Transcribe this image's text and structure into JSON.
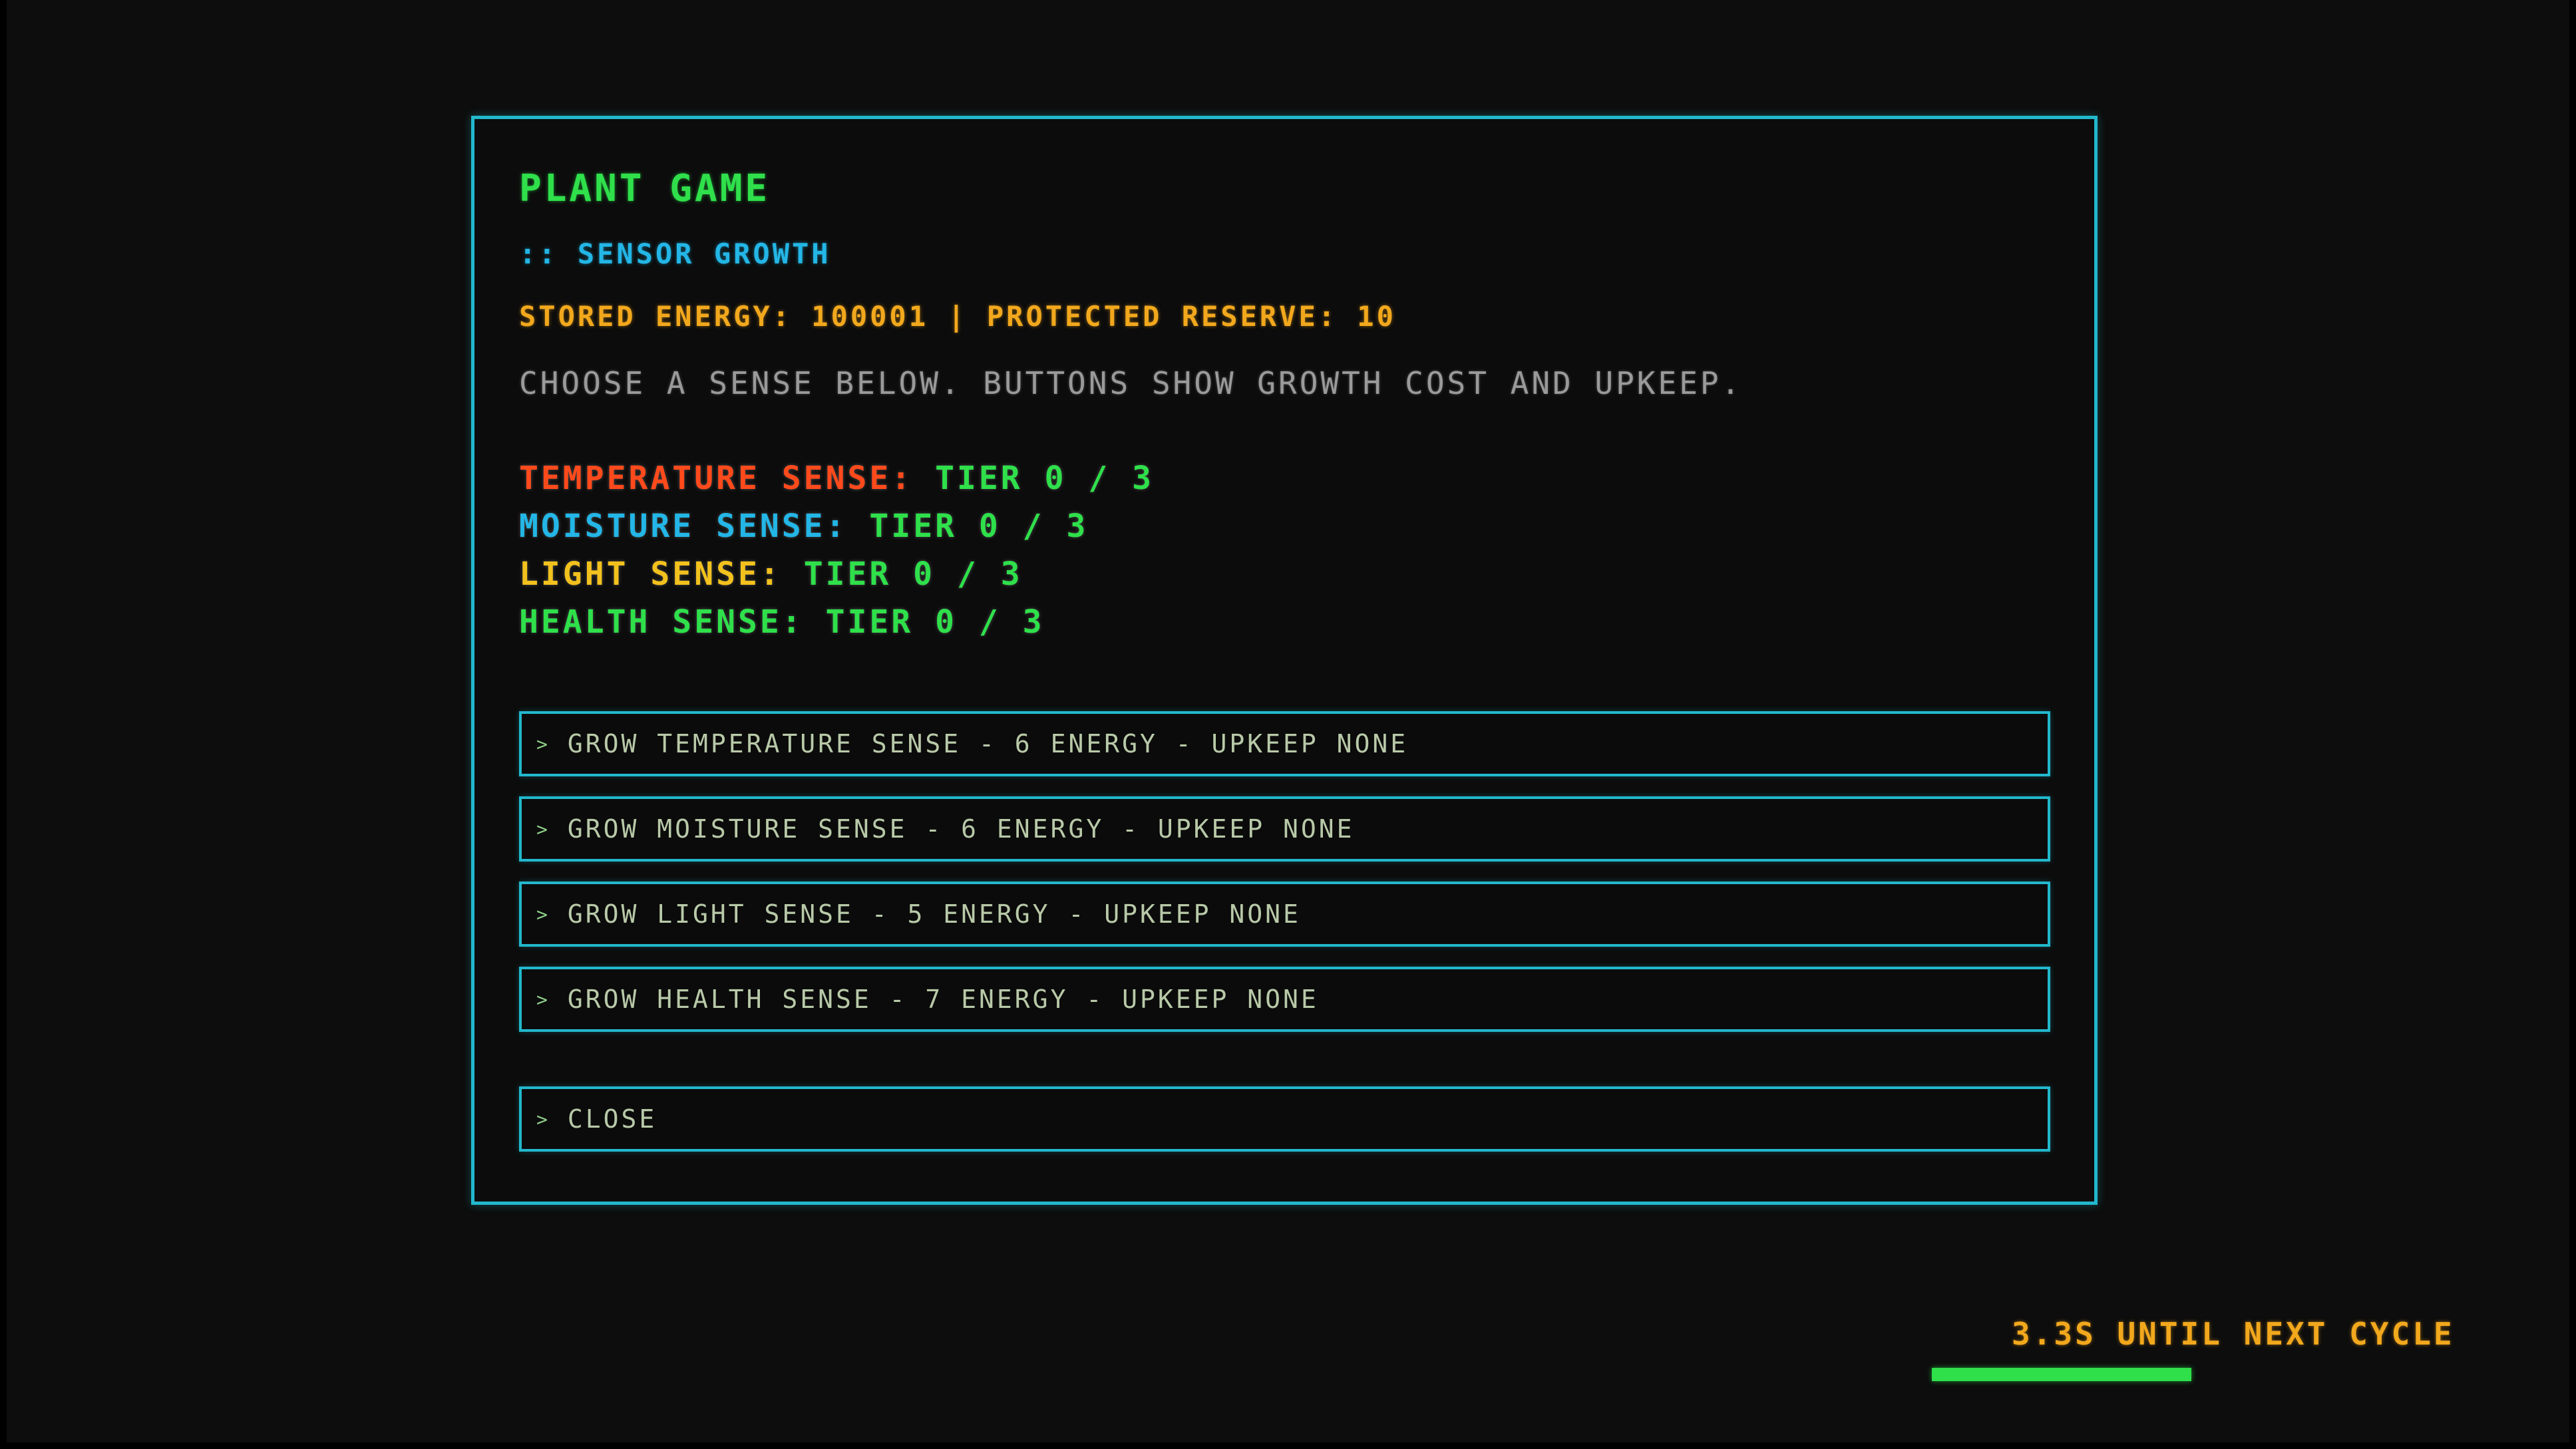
{
  "game": {
    "title": "PLANT GAME",
    "subtitle": ":: SENSOR GROWTH",
    "energy_line": "STORED ENERGY: 100001 | PROTECTED RESERVE: 10",
    "instructions": "CHOOSE A SENSE BELOW. BUTTONS SHOW GROWTH COST AND UPKEEP."
  },
  "senses": [
    {
      "name": "TEMPERATURE SENSE:",
      "tier": "TIER 0 / 3",
      "color": "#ff4a1c"
    },
    {
      "name": "MOISTURE SENSE:",
      "tier": "TIER 0 / 3",
      "color": "#23b6e6"
    },
    {
      "name": "LIGHT SENSE:",
      "tier": "TIER 0 / 3",
      "color": "#f2c11d"
    },
    {
      "name": "HEALTH SENSE:",
      "tier": "TIER 0 / 3",
      "color": "#2fe04b"
    }
  ],
  "buttons": [
    {
      "icon": "chevron-right-icon",
      "label": "GROW TEMPERATURE SENSE - 6 ENERGY - UPKEEP NONE"
    },
    {
      "icon": "chevron-right-icon",
      "label": "GROW MOISTURE SENSE - 6 ENERGY - UPKEEP NONE"
    },
    {
      "icon": "chevron-right-icon",
      "label": "GROW LIGHT SENSE - 5 ENERGY - UPKEEP NONE"
    },
    {
      "icon": "chevron-right-icon",
      "label": "GROW HEALTH SENSE - 7 ENERGY - UPKEEP NONE"
    },
    {
      "icon": "chevron-right-icon",
      "label": "CLOSE"
    }
  ],
  "chevron_glyph": ">",
  "cycle": {
    "text": "3.3S UNTIL NEXT CYCLE",
    "progress": 0.68
  },
  "colors": {
    "accent": "#22b8cc",
    "green": "#2fe04b",
    "amber": "#f2a81d",
    "background": "#0d0d0d"
  }
}
